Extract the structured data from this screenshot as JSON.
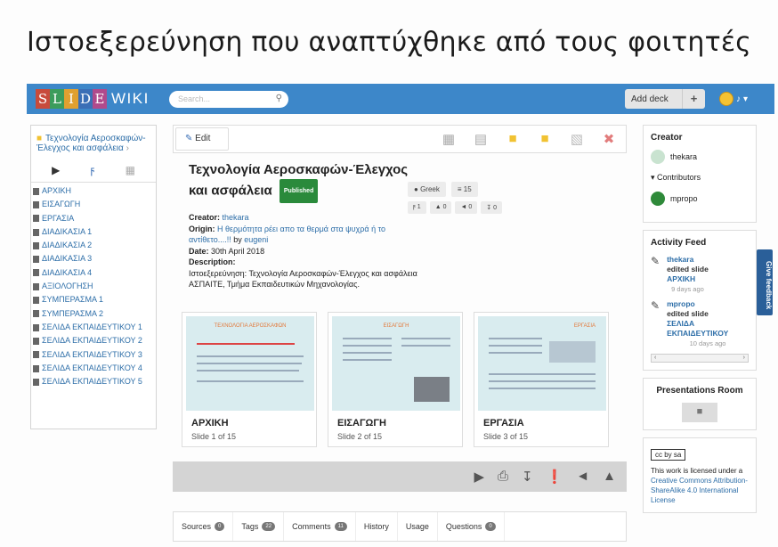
{
  "slide": {
    "title": "Ιστοεξερεύνηση που αναπτύχθηκε από τους φοιτητές"
  },
  "header": {
    "logo_letters": [
      "S",
      "L",
      "I",
      "D",
      "E"
    ],
    "logo_wiki": "WIKI",
    "search_placeholder": "Search...",
    "add_deck": "Add deck",
    "plus": "+"
  },
  "left": {
    "deck_title": "Τεχνολογία Αεροσκαφών-Έλεγχος και ασφάλεια",
    "items": [
      "ΑΡΧΙΚΗ",
      "ΕΙΣΑΓΩΓΗ",
      "ΕΡΓΑΣΙΑ",
      "ΔΙΑΔΙΚΑΣΙΑ 1",
      "ΔΙΑΔΙΚΑΣΙΑ 2",
      "ΔΙΑΔΙΚΑΣΙΑ 3",
      "ΔΙΑΔΙΚΑΣΙΑ 4",
      "ΑΞΙΟΛΟΓΗΣΗ",
      "ΣΥΜΠΕΡΑΣΜΑ 1",
      "ΣΥΜΠΕΡΑΣΜΑ 2",
      "ΣΕΛΙΔΑ ΕΚΠΑΙΔΕΥΤΙΚΟΥ 1",
      "ΣΕΛΙΔΑ ΕΚΠΑΙΔΕΥΤΙΚΟΥ 2",
      "ΣΕΛΙΔΑ ΕΚΠΑΙΔΕΥΤΙΚΟΥ 3",
      "ΣΕΛΙΔΑ ΕΚΠΑΙΔΕΥΤΙΚΟΥ 4",
      "ΣΕΛΙΔΑ ΕΚΠΑΙΔΕΥΤΙΚΟΥ 5"
    ]
  },
  "toolbar": {
    "edit": "Edit"
  },
  "deck": {
    "title": "Τεχνολογία Αεροσκαφών-Έλεγχος και ασφάλεια",
    "published": "Published",
    "language": "Greek",
    "slide_count": "15",
    "forks": "1",
    "likes": "0",
    "shares": "0",
    "downloads": "0",
    "creator_label": "Creator:",
    "creator": "thekara",
    "origin_label": "Origin:",
    "origin": "Η θερμότητα ρέει απο τα θερμά στα ψυχρά ή το αντίθετο....!!",
    "origin_by": "by",
    "origin_user": "eugeni",
    "date_label": "Date:",
    "date": "30th April 2018",
    "description_label": "Description:",
    "description": "Ιστοεξερεύνηση: Τεχνολογία Αεροσκαφών-Έλεγχος και ασφάλεια ΑΣΠΑΙΤΕ, Τμήμα Εκπαιδευτικών Μηχανολογίας."
  },
  "thumbnails": [
    {
      "title": "ΑΡΧΙΚΗ",
      "sub": "Slide 1 of 15",
      "heading": "ΤΕΧΝΟΛΟΓΙΑ ΑΕΡΟΣΚΑΦΩΝ"
    },
    {
      "title": "ΕΙΣΑΓΩΓΗ",
      "sub": "Slide 2 of 15",
      "heading": "ΕΙΣΑΓΩΓΗ"
    },
    {
      "title": "ΕΡΓΑΣΙΑ",
      "sub": "Slide 3 of 15",
      "heading": "ΕΡΓΑΣΙΑ"
    }
  ],
  "tabs": [
    {
      "label": "Sources",
      "count": "0"
    },
    {
      "label": "Tags",
      "count": "22"
    },
    {
      "label": "Comments",
      "count": "11"
    },
    {
      "label": "History",
      "count": ""
    },
    {
      "label": "Usage",
      "count": ""
    },
    {
      "label": "Questions",
      "count": "0"
    }
  ],
  "right": {
    "creator_title": "Creator",
    "creator": "thekara",
    "contributors": "Contributors",
    "contributor": "mpropo",
    "activity_title": "Activity Feed",
    "activities": [
      {
        "user": "thekara",
        "action": "edited slide",
        "target": "ΑΡΧΙΚΗ",
        "time": "9 days ago"
      },
      {
        "user": "mpropo",
        "action": "edited slide",
        "target": "ΣΕΛΙΔΑ ΕΚΠΑΙΔΕΥΤΙΚΟΥ",
        "time": "10 days ago"
      }
    ],
    "rooms_title": "Presentations Room",
    "cc_badge": "cc by sa",
    "license_text": "This work is licensed under a",
    "license_link": "Creative Commons Attribution-ShareAlike 4.0 International License"
  },
  "feedback": "Give feedback"
}
